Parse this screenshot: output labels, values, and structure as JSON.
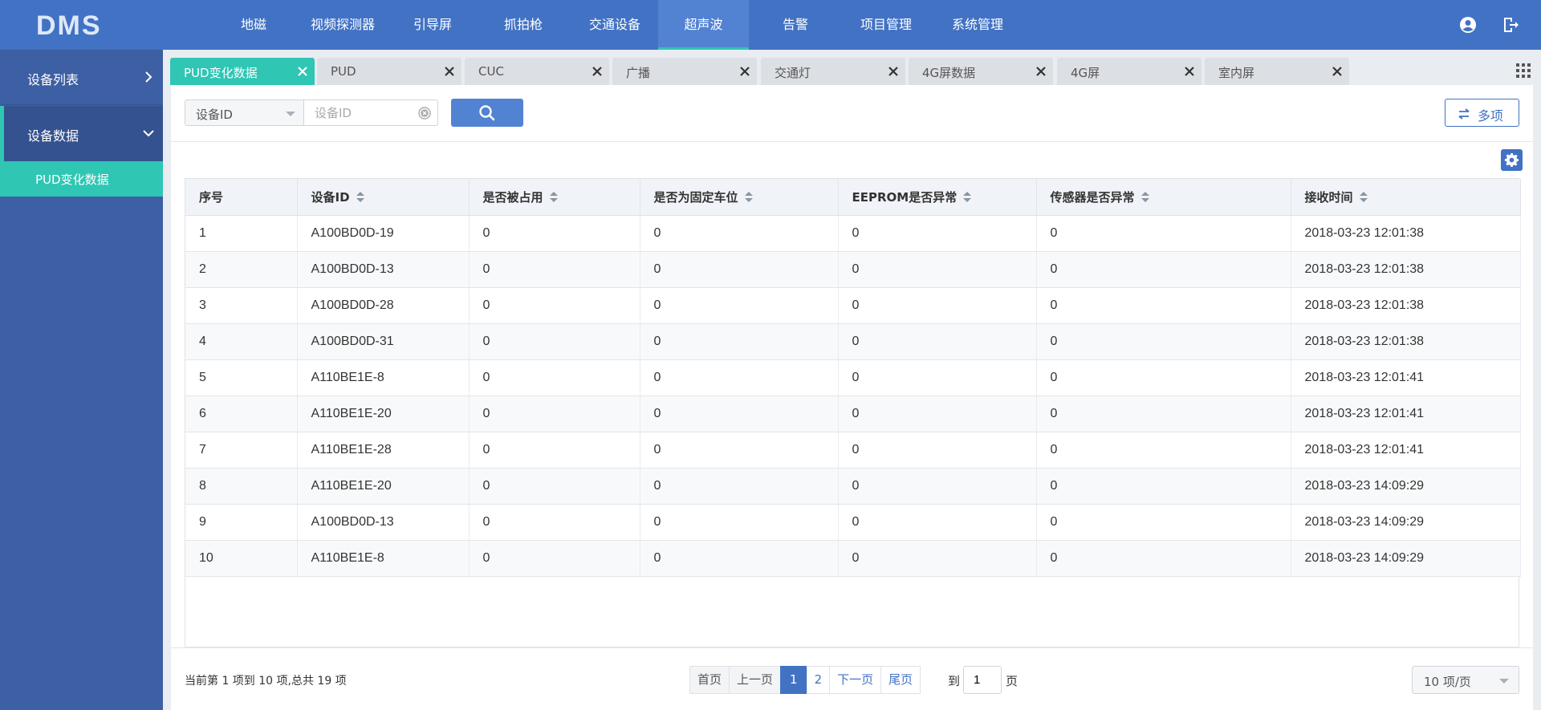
{
  "app": {
    "logo_text": "DMS"
  },
  "nav": {
    "items": [
      {
        "label": "地磁"
      },
      {
        "label": "视频探测器"
      },
      {
        "label": "引导屏"
      },
      {
        "label": "抓拍枪"
      },
      {
        "label": "交通设备"
      },
      {
        "label": "超声波",
        "active": true
      },
      {
        "label": "告警"
      },
      {
        "label": "项目管理"
      },
      {
        "label": "系统管理"
      }
    ]
  },
  "sidebar": {
    "items": [
      {
        "label": "设备列表"
      },
      {
        "label": "设备数据",
        "expanded": true
      }
    ],
    "sub_items": [
      {
        "label": "PUD变化数据",
        "active": true
      }
    ]
  },
  "tabs": [
    {
      "label": "PUD变化数据",
      "active": true
    },
    {
      "label": "PUD"
    },
    {
      "label": "CUC"
    },
    {
      "label": "广播"
    },
    {
      "label": "交通灯"
    },
    {
      "label": "4G屏数据"
    },
    {
      "label": "4G屏"
    },
    {
      "label": "室内屏"
    }
  ],
  "search": {
    "field_select": "设备ID",
    "value": "",
    "placeholder": "设备ID",
    "multi_label": "多项"
  },
  "table": {
    "columns": [
      "序号",
      "设备ID",
      "是否被占用",
      "是否为固定车位",
      "EEPROM是否异常",
      "传感器是否异常",
      "接收时间"
    ],
    "rows": [
      [
        "1",
        "A100BD0D-19",
        "0",
        "0",
        "0",
        "0",
        "2018-03-23 12:01:38"
      ],
      [
        "2",
        "A100BD0D-13",
        "0",
        "0",
        "0",
        "0",
        "2018-03-23 12:01:38"
      ],
      [
        "3",
        "A100BD0D-28",
        "0",
        "0",
        "0",
        "0",
        "2018-03-23 12:01:38"
      ],
      [
        "4",
        "A100BD0D-31",
        "0",
        "0",
        "0",
        "0",
        "2018-03-23 12:01:38"
      ],
      [
        "5",
        "A110BE1E-8",
        "0",
        "0",
        "0",
        "0",
        "2018-03-23 12:01:41"
      ],
      [
        "6",
        "A110BE1E-20",
        "0",
        "0",
        "0",
        "0",
        "2018-03-23 12:01:41"
      ],
      [
        "7",
        "A110BE1E-28",
        "0",
        "0",
        "0",
        "0",
        "2018-03-23 12:01:41"
      ],
      [
        "8",
        "A110BE1E-20",
        "0",
        "0",
        "0",
        "0",
        "2018-03-23 14:09:29"
      ],
      [
        "9",
        "A100BD0D-13",
        "0",
        "0",
        "0",
        "0",
        "2018-03-23 14:09:29"
      ],
      [
        "10",
        "A110BE1E-8",
        "0",
        "0",
        "0",
        "0",
        "2018-03-23 14:09:29"
      ]
    ]
  },
  "footer": {
    "info": "当前第 1 项到 10 项,总共 19 项",
    "pager": {
      "first": "首页",
      "prev": "上一页",
      "pages": [
        "1",
        "2"
      ],
      "current": "1",
      "next": "下一页",
      "last": "尾页"
    },
    "goto_prefix": "到",
    "goto_value": "1",
    "goto_suffix": "页",
    "page_size": "10 项/页"
  },
  "colors": {
    "header_bg": "#4272c4",
    "sidebar_bg": "#3d5fa3",
    "accent_teal": "#2fc6b4",
    "primary_blue": "#5282d2"
  },
  "icons": [
    "user-icon",
    "logout-icon",
    "chevron-right-icon",
    "chevron-down-icon",
    "close-icon",
    "grid-icon",
    "search-icon",
    "clear-icon",
    "swap-icon",
    "gear-icon",
    "sort-icon",
    "collapse-left-icon"
  ]
}
